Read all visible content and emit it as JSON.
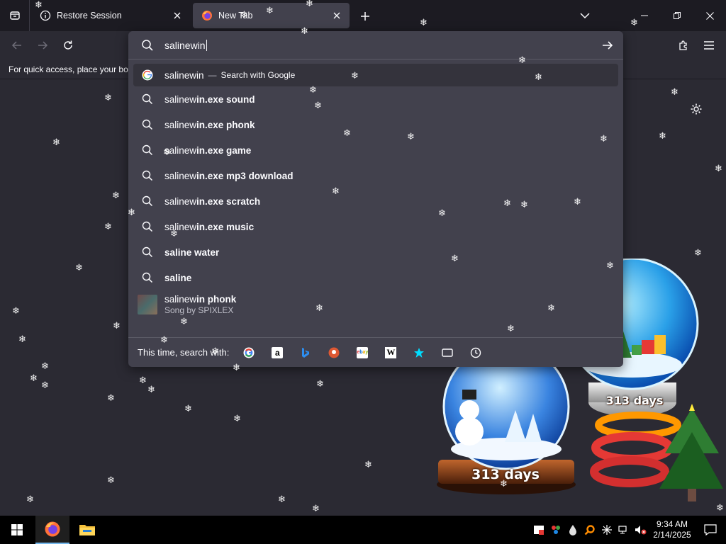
{
  "tabs": [
    {
      "label": "Restore Session",
      "icon": "info-icon"
    },
    {
      "label": "New Tab",
      "icon": "firefox-icon"
    }
  ],
  "bookmarks_bar": {
    "text": "For quick access, place your bookmarks here on the bookmarks toolbar."
  },
  "urlbar": {
    "value": "salinewin",
    "first_row": {
      "text": "salinewin",
      "separator": "—",
      "action": "Search with Google"
    },
    "suggestions": [
      {
        "prefix": "salinew",
        "bold": "in.exe sound"
      },
      {
        "prefix": "salinew",
        "bold": "in.exe phonk"
      },
      {
        "prefix": "salinew",
        "bold": "in.exe game"
      },
      {
        "prefix": "salinew",
        "bold": "in.exe mp3 download"
      },
      {
        "prefix": "salinew",
        "bold": "in.exe scratch"
      },
      {
        "prefix": "salinew",
        "bold": "in.exe music"
      },
      {
        "prefix": "",
        "bold": "saline water"
      },
      {
        "prefix": "",
        "bold": "saline"
      }
    ],
    "rich_result": {
      "prefix": "salinew",
      "bold": "in phonk",
      "subtitle": "Song by SPIXLEX"
    },
    "engines_label": "This time, search with:",
    "engines": [
      "Google",
      "Amazon",
      "Bing",
      "DuckDuckGo",
      "eBay",
      "Wikipedia",
      "Bookmarks",
      "Tabs",
      "History"
    ]
  },
  "globes": {
    "left_text": "313 days",
    "right_text": "313 days"
  },
  "taskbar": {
    "time": "9:34 AM",
    "date": "2/14/2025"
  },
  "colors": {
    "accent": "#76b9ed",
    "panel": "#42414d",
    "background": "#2b2a33"
  }
}
